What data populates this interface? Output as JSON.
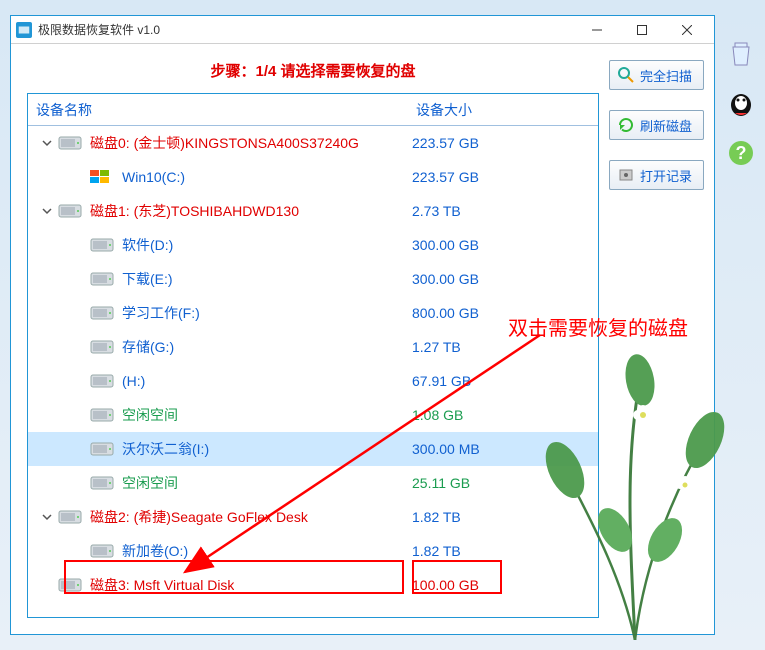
{
  "window": {
    "title": "极限数据恢复软件 v1.0"
  },
  "step": {
    "label": "步骤：1/4 请选择需要恢复的盘"
  },
  "columns": {
    "name": "设备名称",
    "size": "设备大小"
  },
  "tree": [
    {
      "indent": 0,
      "expand": "open",
      "icon": "disk",
      "name": "磁盘0: (金士顿)KINGSTONSA400S37240G",
      "size": "223.57 GB",
      "nameColor": "red",
      "sizeColor": "blue"
    },
    {
      "indent": 1,
      "expand": "none",
      "icon": "win",
      "name": "Win10(C:)",
      "size": "223.57 GB",
      "nameColor": "blue",
      "sizeColor": "blue"
    },
    {
      "indent": 0,
      "expand": "open",
      "icon": "disk",
      "name": "磁盘1: (东芝)TOSHIBAHDWD130",
      "size": "2.73 TB",
      "nameColor": "red",
      "sizeColor": "blue"
    },
    {
      "indent": 1,
      "expand": "none",
      "icon": "disk",
      "name": "软件(D:)",
      "size": "300.00 GB",
      "nameColor": "blue",
      "sizeColor": "blue"
    },
    {
      "indent": 1,
      "expand": "none",
      "icon": "disk",
      "name": "下载(E:)",
      "size": "300.00 GB",
      "nameColor": "blue",
      "sizeColor": "blue"
    },
    {
      "indent": 1,
      "expand": "none",
      "icon": "disk",
      "name": "学习工作(F:)",
      "size": "800.00 GB",
      "nameColor": "blue",
      "sizeColor": "blue"
    },
    {
      "indent": 1,
      "expand": "none",
      "icon": "disk",
      "name": "存储(G:)",
      "size": "1.27 TB",
      "nameColor": "blue",
      "sizeColor": "blue"
    },
    {
      "indent": 1,
      "expand": "none",
      "icon": "disk",
      "name": "(H:)",
      "size": "67.91 GB",
      "nameColor": "blue",
      "sizeColor": "blue"
    },
    {
      "indent": 1,
      "expand": "none",
      "icon": "disk",
      "name": "空闲空间",
      "size": "1.08 GB",
      "nameColor": "green",
      "sizeColor": "green"
    },
    {
      "indent": 1,
      "expand": "none",
      "icon": "disk",
      "name": "沃尔沃二翁(I:)",
      "size": "300.00 MB",
      "nameColor": "blue",
      "sizeColor": "blue",
      "selected": true
    },
    {
      "indent": 1,
      "expand": "none",
      "icon": "disk",
      "name": "空闲空间",
      "size": "25.11 GB",
      "nameColor": "green",
      "sizeColor": "green"
    },
    {
      "indent": 0,
      "expand": "open",
      "icon": "disk",
      "name": "磁盘2: (希捷)Seagate  GoFlex Desk",
      "size": "1.82 TB",
      "nameColor": "red",
      "sizeColor": "blue"
    },
    {
      "indent": 1,
      "expand": "none",
      "icon": "disk",
      "name": "新加卷(O:)",
      "size": "1.82 TB",
      "nameColor": "blue",
      "sizeColor": "blue"
    },
    {
      "indent": 0,
      "expand": "none-root",
      "icon": "disk",
      "name": "磁盘3: Msft     Virtual Disk",
      "size": "100.00 GB",
      "nameColor": "red",
      "sizeColor": "red"
    }
  ],
  "sideButtons": {
    "scan": "完全扫描",
    "refresh": "刷新磁盘",
    "openLog": "打开记录"
  },
  "annotation": {
    "text": "双击需要恢复的磁盘"
  }
}
